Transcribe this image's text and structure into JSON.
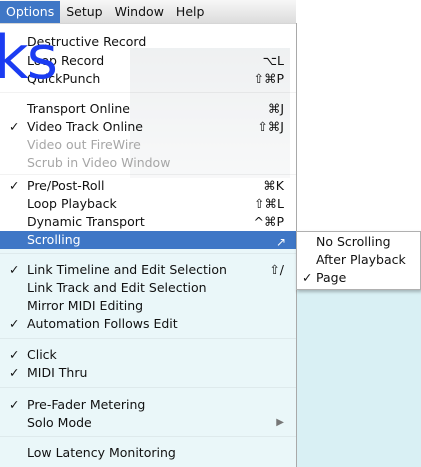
{
  "menubar": [
    "Options",
    "Setup",
    "Window",
    "Help"
  ],
  "overlay": "ks",
  "menu": {
    "items": [
      {
        "check": "",
        "label": "Destructive Record",
        "shortcut": ""
      },
      {
        "check": "",
        "label": "Loop Record",
        "shortcut": "⌥L"
      },
      {
        "check": "",
        "label": "QuickPunch",
        "shortcut": "⇧⌘P"
      },
      {
        "check": "",
        "label": "Transport Online",
        "shortcut": "⌘J"
      },
      {
        "check": "✓",
        "label": "Video Track Online",
        "shortcut": "⇧⌘J"
      },
      {
        "check": "",
        "label": "Video out FireWire",
        "shortcut": "",
        "disabled": true
      },
      {
        "check": "",
        "label": "Scrub in Video Window",
        "shortcut": "",
        "disabled": true
      },
      {
        "check": "✓",
        "label": "Pre/Post-Roll",
        "shortcut": "⌘K"
      },
      {
        "check": "",
        "label": "Loop Playback",
        "shortcut": "⇧⌘L"
      },
      {
        "check": "",
        "label": "Dynamic Transport",
        "shortcut": "^⌘P"
      },
      {
        "check": "",
        "label": "Scrolling",
        "shortcut": "",
        "highlighted": true
      },
      {
        "check": "✓",
        "label": "Link Timeline and Edit Selection",
        "shortcut": "⇧/"
      },
      {
        "check": "",
        "label": "Link Track and Edit Selection",
        "shortcut": ""
      },
      {
        "check": "",
        "label": "Mirror MIDI Editing",
        "shortcut": ""
      },
      {
        "check": "✓",
        "label": "Automation Follows Edit",
        "shortcut": ""
      },
      {
        "check": "✓",
        "label": "Click",
        "shortcut": ""
      },
      {
        "check": "✓",
        "label": "MIDI Thru",
        "shortcut": ""
      },
      {
        "check": "✓",
        "label": "Pre-Fader Metering",
        "shortcut": ""
      },
      {
        "check": "",
        "label": "Solo Mode",
        "shortcut": "▶"
      },
      {
        "check": "",
        "label": "Low Latency Monitoring",
        "shortcut": ""
      }
    ]
  },
  "submenu": {
    "items": [
      {
        "check": "",
        "label": "No Scrolling"
      },
      {
        "check": "",
        "label": "After Playback"
      },
      {
        "check": "✓",
        "label": "Page"
      }
    ]
  }
}
